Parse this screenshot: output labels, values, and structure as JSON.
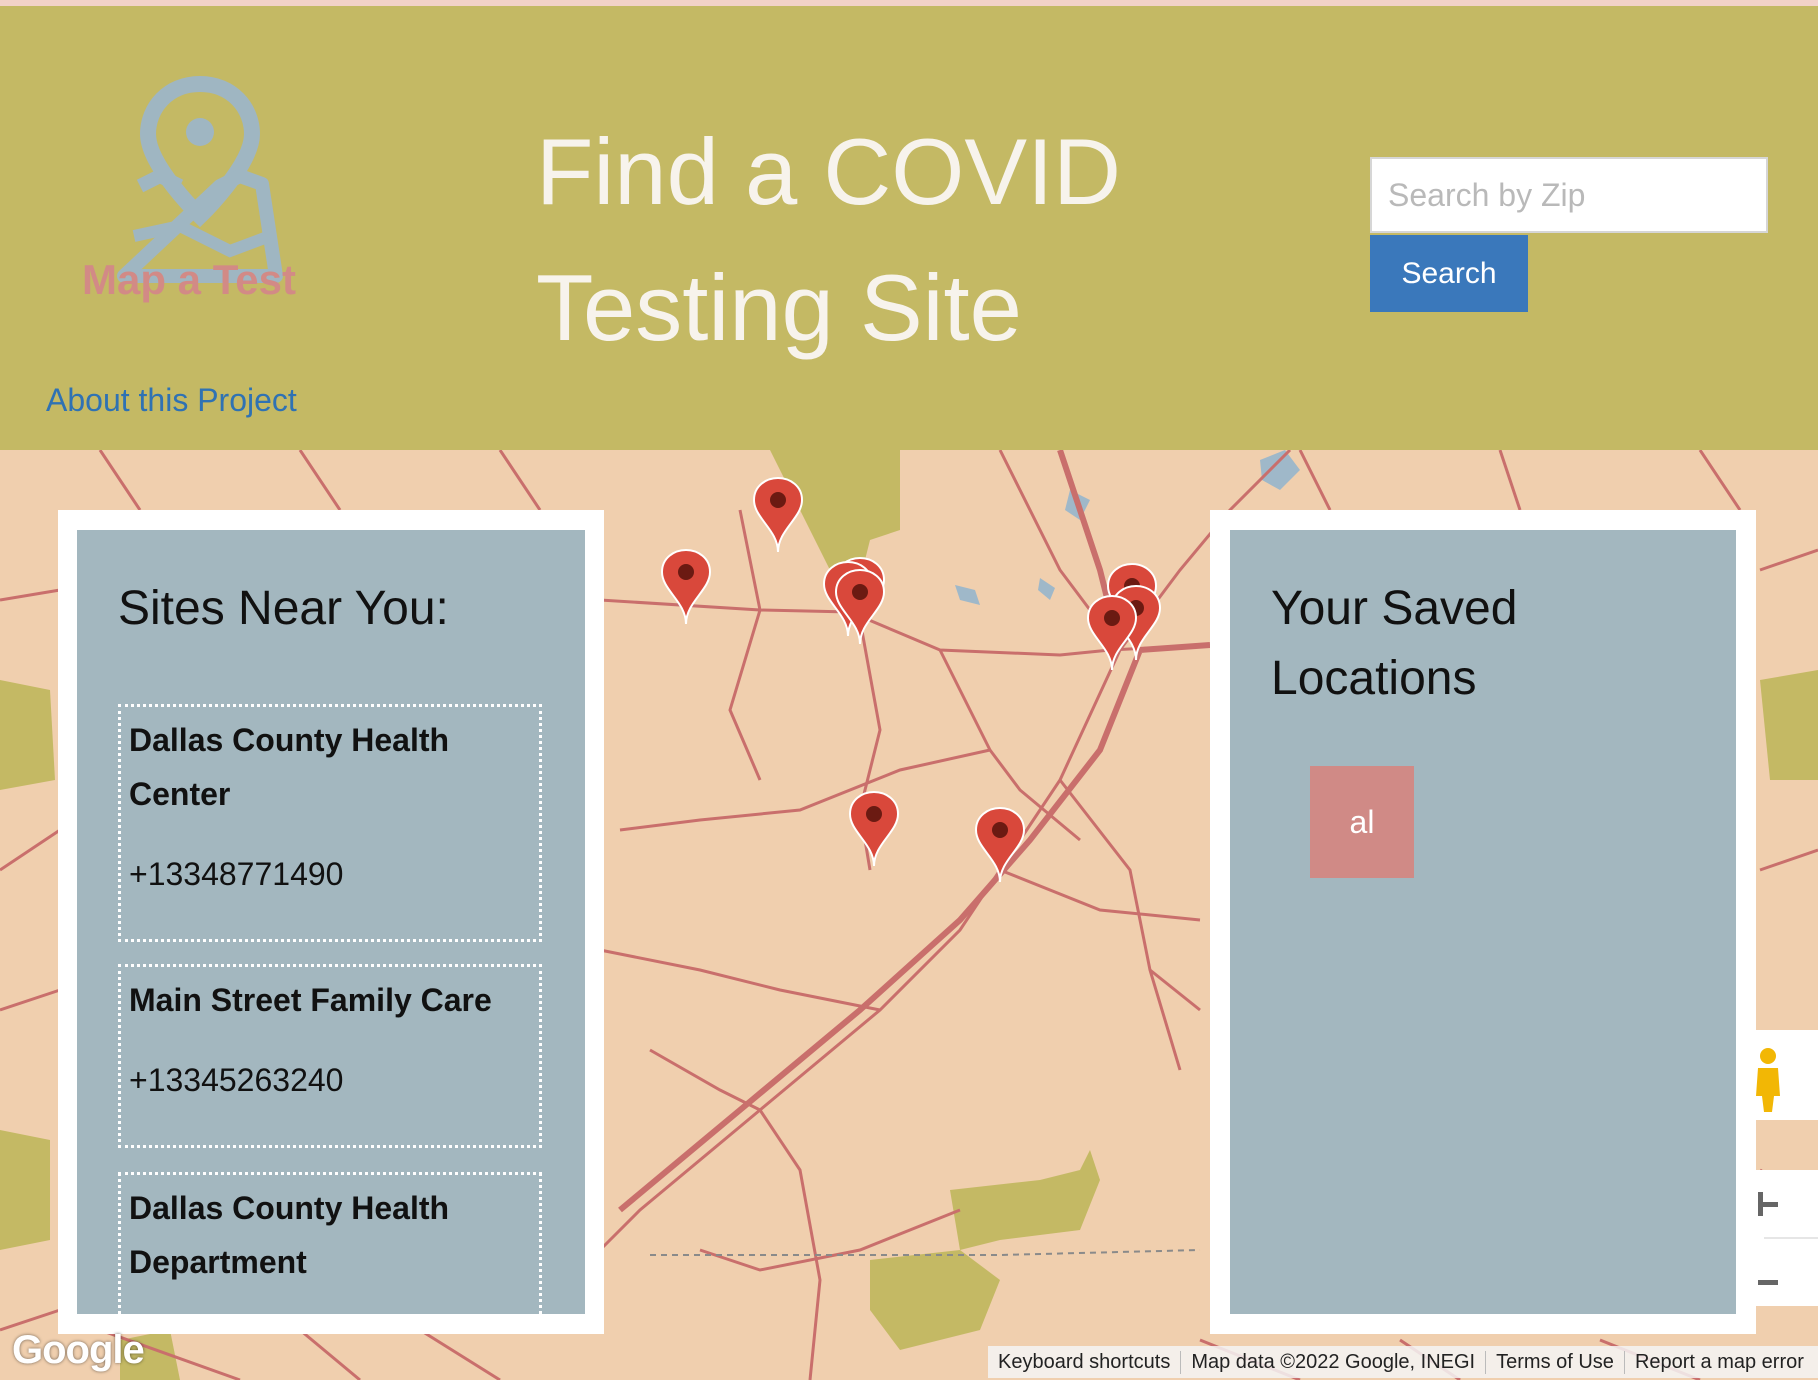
{
  "header": {
    "logo_text": "Map a Test",
    "title_line1": "Find a COVID",
    "title_line2": "Testing Site",
    "about_link": "About this Project",
    "search_placeholder": "Search by Zip",
    "search_button": "Search"
  },
  "sites_panel": {
    "title": "Sites Near You:",
    "sites": [
      {
        "name": "Dallas County Health Center",
        "phone": "+13348771490"
      },
      {
        "name": "Main Street Family Care",
        "phone": "+13345263240"
      },
      {
        "name": "Dallas County Health Department",
        "phone": ""
      }
    ]
  },
  "saved_panel": {
    "title": "Your Saved Locations",
    "items": [
      "al"
    ]
  },
  "map": {
    "brand": "Google",
    "attribution": [
      "Keyboard shortcuts",
      "Map data ©2022 Google, INEGI",
      "Terms of Use",
      "Report a map error"
    ],
    "marker_count": 10,
    "colors": {
      "land": "#f0cfae",
      "roads": "#c96f6c",
      "parks": "#c4b964",
      "water": "#9fb8c9",
      "marker": "#d9483b"
    }
  },
  "colors": {
    "header_bg": "#c4b964",
    "panel_bg": "#a3b7bf",
    "button_bg": "#3a78bb",
    "link": "#2f72b3",
    "chip_bg": "#d08a86"
  }
}
